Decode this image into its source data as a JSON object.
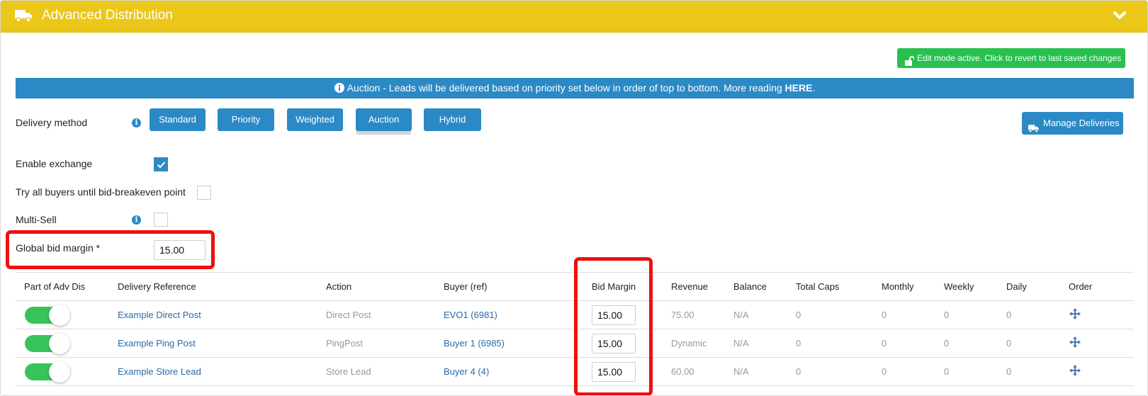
{
  "header": {
    "title": "Advanced Distribution",
    "icon": "truck-icon",
    "collapse_icon": "chevron-down-icon",
    "color": "#ebc71a"
  },
  "edit_mode": {
    "label": "Edit mode active. Click to revert to last saved changes",
    "icon": "unlock-icon",
    "color": "#28c14f"
  },
  "banner": {
    "icon": "info-icon",
    "text": "Auction - Leads will be delivered based on priority set below in order of top to bottom. More reading ",
    "link": "HERE",
    "tail": ".",
    "color": "#2b8ac6"
  },
  "delivery_method": {
    "label": "Delivery method",
    "options": [
      "Standard",
      "Priority",
      "Weighted",
      "Auction",
      "Hybrid"
    ],
    "selected": "Auction"
  },
  "manage_deliveries": {
    "label": "Manage Deliveries",
    "icon": "truck-icon"
  },
  "settings": {
    "enable_exchange": {
      "label": "Enable exchange",
      "checked": true
    },
    "try_all_buyers": {
      "label": "Try all buyers until bid-breakeven point",
      "checked": false
    },
    "multi_sell": {
      "label": "Multi-Sell",
      "checked": false
    },
    "global_bid_margin": {
      "label": "Global bid margin *",
      "value": "15.00"
    }
  },
  "table": {
    "columns": [
      "Part of Adv Dis",
      "Delivery Reference",
      "Action",
      "Buyer (ref)",
      "Bid Margin",
      "Revenue",
      "Balance",
      "Total Caps",
      "Monthly",
      "Weekly",
      "Daily",
      "Order"
    ],
    "rows": [
      {
        "enabled": true,
        "reference": "Example Direct Post",
        "action": "Direct Post",
        "buyer": "EVO1 (6981)",
        "bid_margin": "15.00",
        "revenue": "75.00",
        "balance": "N/A",
        "total_caps": "0",
        "monthly": "0",
        "weekly": "0",
        "daily": "0",
        "order_icon": "move-icon"
      },
      {
        "enabled": true,
        "reference": "Example Ping Post",
        "action": "PingPost",
        "buyer": "Buyer 1 (6985)",
        "bid_margin": "15.00",
        "revenue": "Dynamic",
        "balance": "N/A",
        "total_caps": "0",
        "monthly": "0",
        "weekly": "0",
        "daily": "0",
        "order_icon": "move-icon"
      },
      {
        "enabled": true,
        "reference": "Example Store Lead",
        "action": "Store Lead",
        "buyer": "Buyer 4 (4)",
        "bid_margin": "15.00",
        "revenue": "60.00",
        "balance": "N/A",
        "total_caps": "0",
        "monthly": "0",
        "weekly": "0",
        "daily": "0",
        "order_icon": "move-icon"
      }
    ]
  },
  "highlight_color": "#f10f0f"
}
